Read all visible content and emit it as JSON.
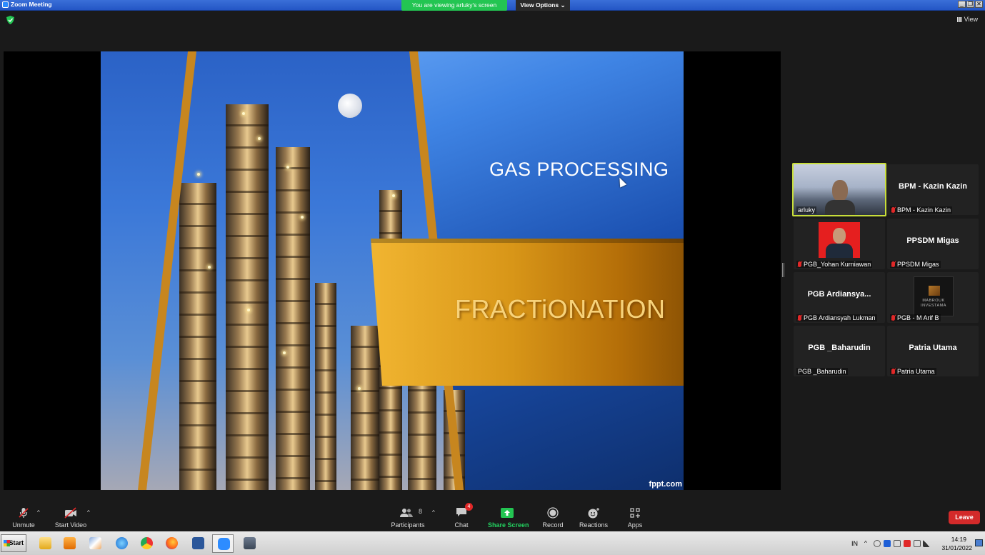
{
  "window": {
    "title": "Zoom Meeting"
  },
  "share_banner": {
    "text": "You are viewing arluky's screen",
    "view_options": "View Options ⌄"
  },
  "view_button": {
    "label": "View"
  },
  "slide": {
    "title": "GAS PROCESSING",
    "subtitle": "FRACTiONATION",
    "credit": "fppt.com"
  },
  "participants": [
    {
      "name": "",
      "label": "arluky",
      "muted": false,
      "video": true
    },
    {
      "name": "BPM - Kazin Kazin",
      "label": "BPM - Kazin Kazin",
      "muted": true
    },
    {
      "name": "",
      "label": "PGB_Yohan Kurniawan",
      "muted": true,
      "photo": true
    },
    {
      "name": "PPSDM Migas",
      "label": "PPSDM Migas",
      "muted": true
    },
    {
      "name": "PGB  Ardiansya...",
      "label": "PGB  Ardiansyah Lukman",
      "muted": true
    },
    {
      "name": "",
      "label": "PGB - M Arif B",
      "muted": true,
      "logo": "MABROUK INVESTAMA"
    },
    {
      "name": "PGB _Baharudin",
      "label": "PGB _Baharudin",
      "muted": false
    },
    {
      "name": "Patria Utama",
      "label": "Patria Utama",
      "muted": true
    }
  ],
  "toolbar": {
    "unmute": "Unmute",
    "start_video": "Start Video",
    "participants": "Participants",
    "participants_count": "8",
    "chat": "Chat",
    "chat_badge": "4",
    "share_screen": "Share Screen",
    "record": "Record",
    "reactions": "Reactions",
    "apps": "Apps",
    "leave": "Leave"
  },
  "taskbar": {
    "start": "Start",
    "lang": "IN",
    "time": "14:19",
    "date": "31/01/2022"
  },
  "colors": {
    "share_green": "#23c552",
    "leave_red": "#d32a2a",
    "active_speaker": "#c8de3a",
    "slide_gold": "#c7861f"
  }
}
